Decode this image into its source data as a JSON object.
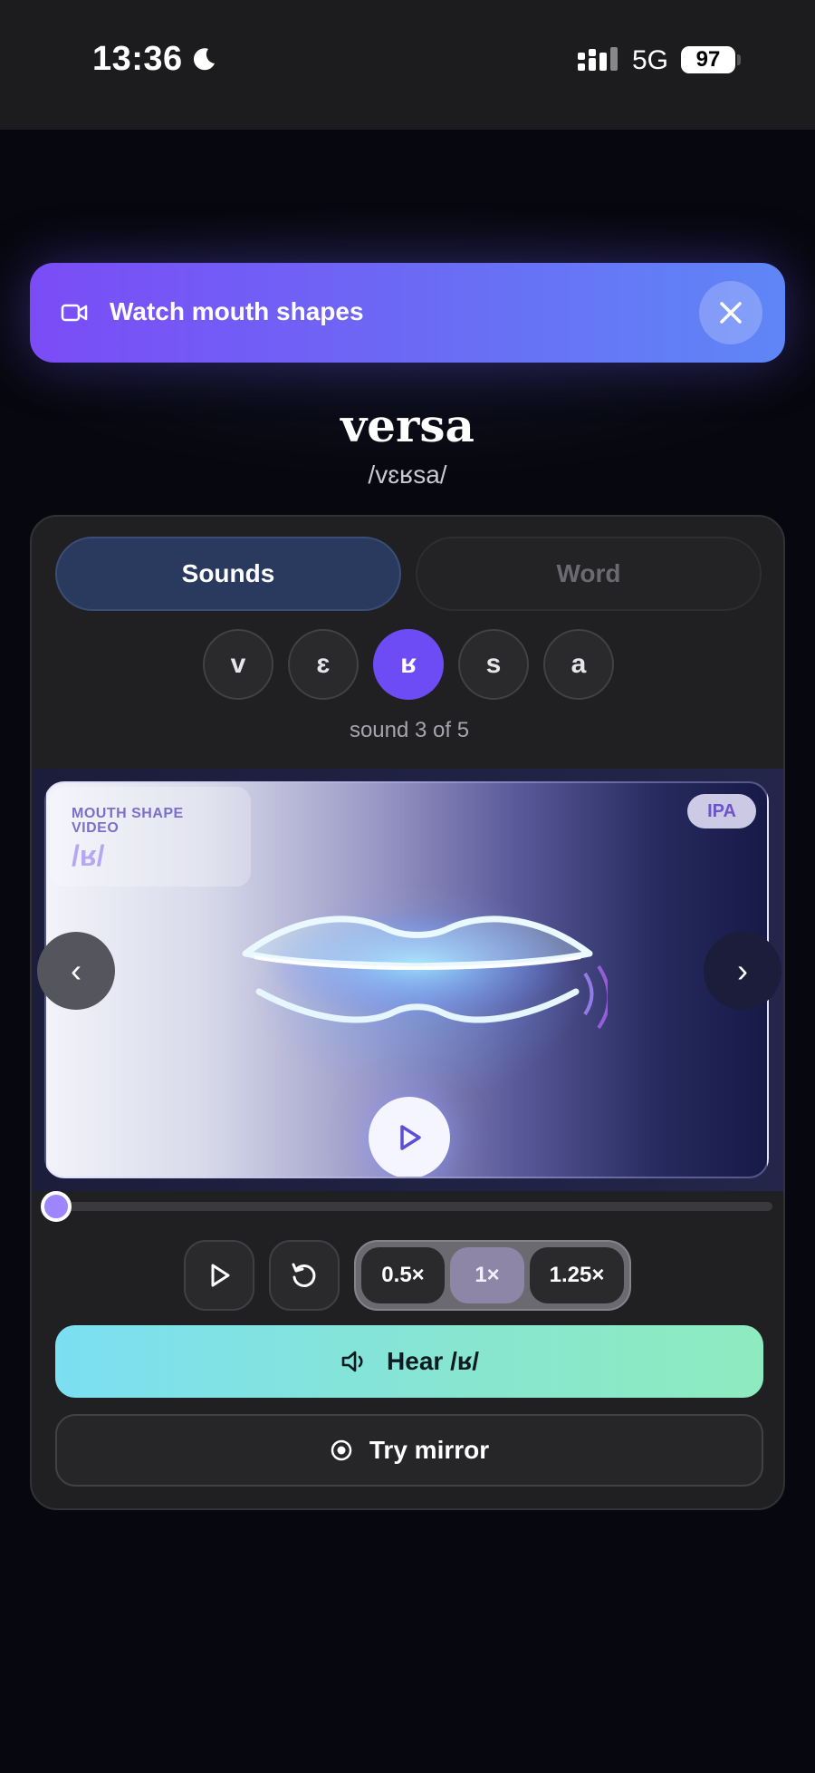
{
  "status_bar": {
    "time": "13:36",
    "network": "5G",
    "battery": "97"
  },
  "banner": {
    "title": "Watch mouth shapes",
    "icon": "video-camera-icon",
    "close_icon": "close-icon",
    "gradient": [
      "#7b4cf6",
      "#5f86f6"
    ]
  },
  "word": {
    "title": "versa",
    "ipa": "/vɛʁsa/"
  },
  "tabs": [
    {
      "label": "Sounds",
      "selected": true
    },
    {
      "label": "Word",
      "selected": false
    }
  ],
  "phonemes": [
    {
      "symbol": "v",
      "active": false
    },
    {
      "symbol": "ɛ",
      "active": false
    },
    {
      "symbol": "ʁ",
      "active": true
    },
    {
      "symbol": "s",
      "active": false
    },
    {
      "symbol": "a",
      "active": false
    }
  ],
  "sound_counter": "sound 3 of 5",
  "video": {
    "label": "MOUTH SHAPE VIDEO",
    "phoneme": "/ʁ/",
    "badge": "IPA",
    "prev_icon": "‹",
    "next_icon": "›",
    "progress": 0.0
  },
  "controls": {
    "play_icon": "play-icon",
    "replay_icon": "replay-icon",
    "speeds": [
      {
        "label": "0.5×",
        "active": false
      },
      {
        "label": "1×",
        "active": true
      },
      {
        "label": "1.25×",
        "active": false
      }
    ]
  },
  "actions": {
    "hear_label": "Hear /ʁ/",
    "mirror_label": "Try mirror"
  },
  "colors": {
    "accent": "#6e4cf5",
    "hear_gradient": [
      "#7cdff2",
      "#8eebbf"
    ]
  }
}
